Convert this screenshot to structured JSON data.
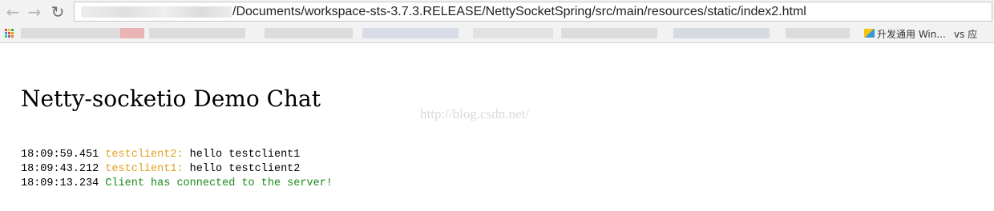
{
  "browser": {
    "back_glyph": "←",
    "forward_glyph": "→",
    "reload_glyph": "↻",
    "address_url": "/Documents/workspace-sts-3.7.3.RELEASE/NettySocketSpring/src/main/resources/static/index2.html"
  },
  "bookmarks": {
    "apps_colors": [
      "#e74c3c",
      "#f1c40f",
      "#27ae60",
      "#3498db",
      "#e74c3c",
      "#f39c12",
      "#2ecc71",
      "#9b59b6",
      "#e67e22"
    ],
    "visible_items": [
      {
        "label": "升发通用 Win...",
        "icon": "folder-icon"
      },
      {
        "label": "vs 应",
        "icon": ""
      }
    ]
  },
  "page": {
    "title": "Netty-socketio Demo Chat",
    "watermark": "http://blog.csdn.net/"
  },
  "messages": [
    {
      "time": "18:09:59.451",
      "user": "testclient2:",
      "text": "hello testclient1",
      "kind": "chat"
    },
    {
      "time": "18:09:43.212",
      "user": "testclient1:",
      "text": "hello testclient2",
      "kind": "chat"
    },
    {
      "time": "18:09:13.234",
      "user": "",
      "text": "Client has connected to the server!",
      "kind": "system"
    }
  ],
  "colors": {
    "username": "#e0a020",
    "system_message": "#1a8a1a",
    "watermark": "#d9d9d9"
  }
}
